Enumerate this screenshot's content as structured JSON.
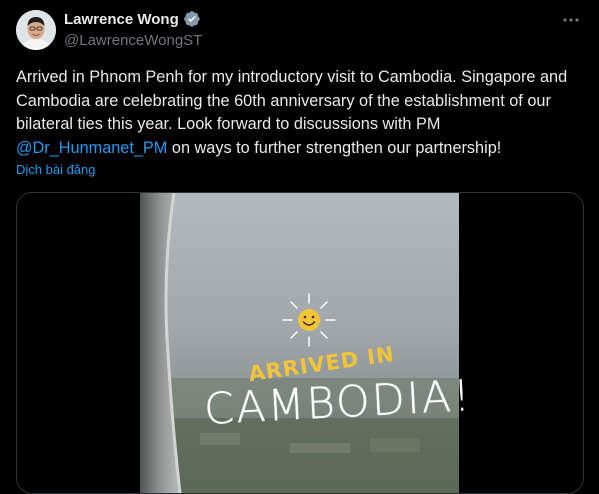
{
  "author": {
    "name": "Lawrence Wong",
    "handle": "@LawrenceWongST",
    "verified": true
  },
  "menu": {
    "more_icon": "more-horizontal-icon"
  },
  "tweet": {
    "text_before": "Arrived in Phnom Penh for my introductory visit to Cambodia. Singapore and Cambodia are celebrating the 60th anniversary of the establishment of our bilateral ties this year. Look forward to discussions with PM ",
    "mention": "@Dr_Hunmanet_PM",
    "text_after": " on ways to further strengthen our partnership!",
    "translate_label": "Dịch bài đăng"
  },
  "media": {
    "caption_top": "ARRIVED IN",
    "caption_main": "CAMBODIA!",
    "sticker_icon": "smiling-sun-icon"
  },
  "colors": {
    "background": "#000000",
    "text": "#e7e9ea",
    "secondary": "#71767b",
    "link": "#1d9bf0",
    "caption_yellow": "#f3c437"
  }
}
